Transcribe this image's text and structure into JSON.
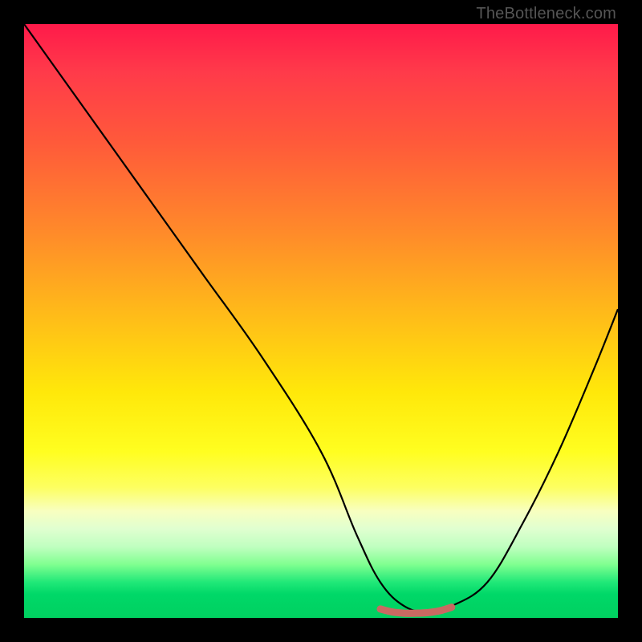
{
  "watermark": "TheBottleneck.com",
  "chart_data": {
    "type": "line",
    "title": "",
    "xlabel": "",
    "ylabel": "",
    "xlim": [
      0,
      100
    ],
    "ylim": [
      0,
      100
    ],
    "series": [
      {
        "name": "bottleneck-curve",
        "x": [
          0,
          10,
          20,
          30,
          40,
          50,
          56,
          60,
          64,
          68,
          72,
          78,
          84,
          90,
          96,
          100
        ],
        "values": [
          100,
          86,
          72,
          58,
          44,
          28,
          14,
          6,
          2,
          1,
          2,
          6,
          16,
          28,
          42,
          52
        ]
      },
      {
        "name": "optimal-range-marker",
        "x": [
          60,
          62,
          64,
          66,
          68,
          70,
          72
        ],
        "values": [
          1.5,
          1.0,
          0.8,
          0.8,
          0.9,
          1.2,
          1.8
        ]
      }
    ],
    "colors": {
      "curve": "#000000",
      "marker": "#c96a62",
      "gradient_top": "#ff1a4a",
      "gradient_mid": "#ffe80a",
      "gradient_bottom": "#00d060"
    }
  }
}
